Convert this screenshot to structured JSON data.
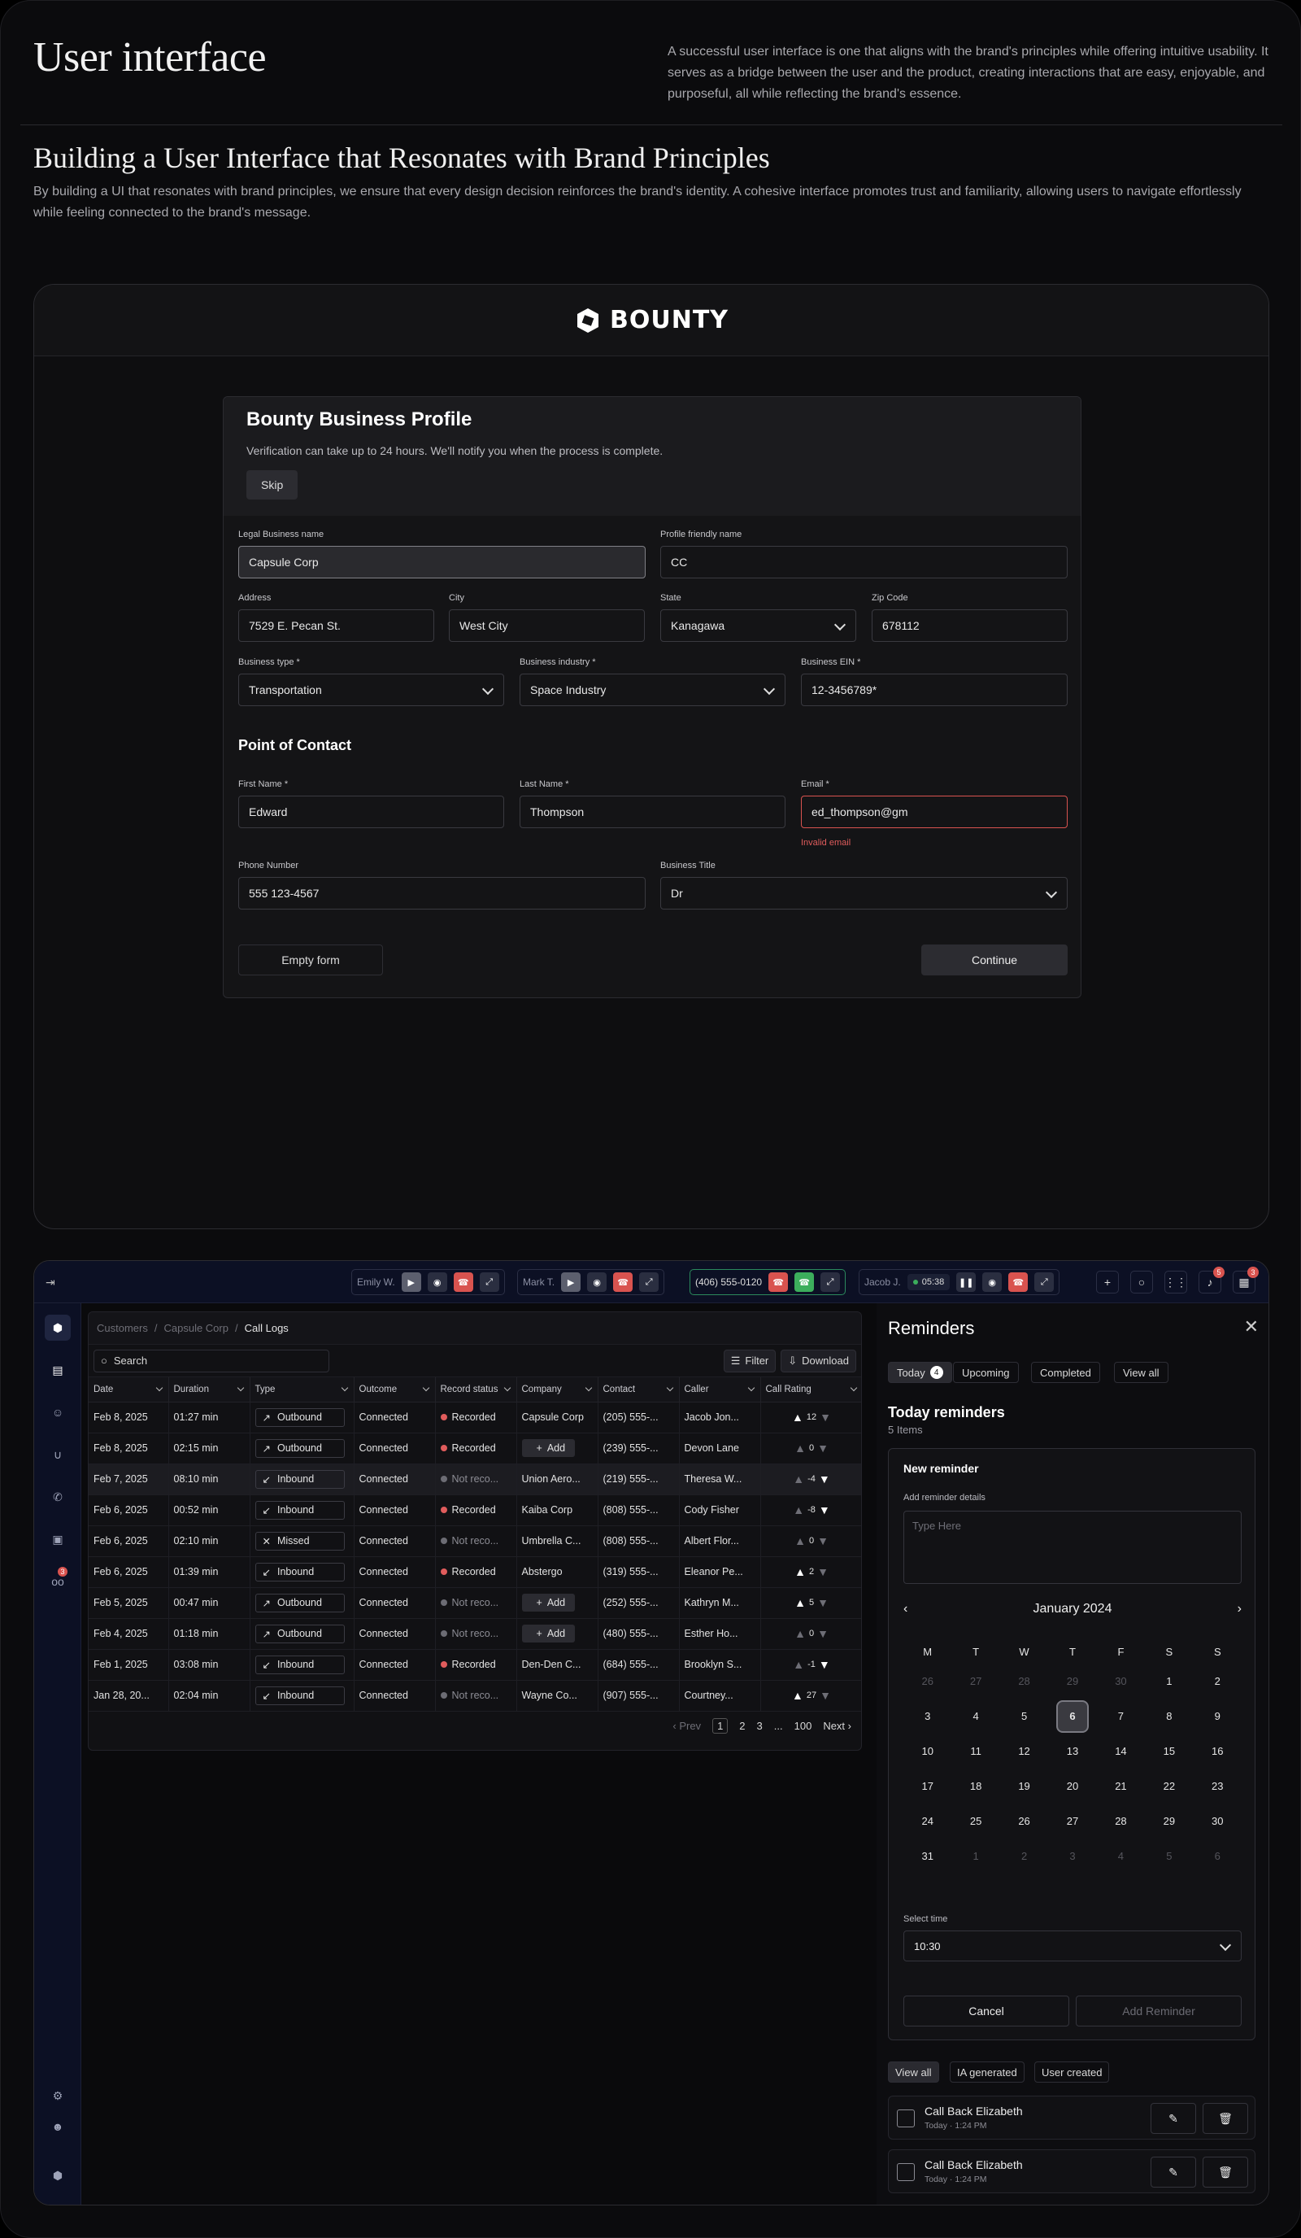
{
  "hero": {
    "title": "User interface",
    "intro": "A successful user interface is one that aligns with the brand's principles while offering intuitive usability. It serves as a bridge between the user and the product, creating interactions that are easy, enjoyable, and purposeful, all while reflecting the brand's essence.",
    "heading": "Building a User Interface that Resonates with Brand Principles",
    "subtext": "By building a UI that resonates with brand principles, we ensure that every design decision reinforces the brand's identity. A cohesive interface promotes trust and familiarity, allowing users to navigate effortlessly while feeling connected to the brand's message."
  },
  "brand": {
    "name": "BOUNTY"
  },
  "profile": {
    "title": "Bounty Business Profile",
    "note": "Verification can take up to 24 hours. We'll notify you when the process is complete.",
    "skip": "Skip",
    "legal_label": "Legal Business name",
    "legal_value": "Capsule Corp",
    "friendly_label": "Profile friendly name",
    "friendly_value": "CC",
    "address_label": "Address",
    "address_value": "7529 E. Pecan St.",
    "city_label": "City",
    "city_value": "West City",
    "state_label": "State",
    "state_value": "Kanagawa",
    "zip_label": "Zip Code",
    "zip_value": "678112",
    "btype_label": "Business type *",
    "btype_value": "Transportation",
    "bindustry_label": "Business industry *",
    "bindustry_value": "Space Industry",
    "ein_label": "Business EIN *",
    "ein_value": "12-3456789*",
    "contact_heading": "Point of Contact",
    "first_label": "First Name *",
    "first_value": "Edward",
    "last_label": "Last Name *",
    "last_value": "Thompson",
    "email_label": "Email *",
    "email_value": "ed_thompson@gm",
    "email_error": "Invalid email",
    "phone_label": "Phone Number",
    "phone_value": "555 123-4567",
    "title_label": "Business Title",
    "title_value": "Dr",
    "empty_button": "Empty form",
    "continue_button": "Continue"
  },
  "callbar": {
    "agent1": "Emily W.",
    "agent2": "Mark T.",
    "live_number": "(406) 555-0120",
    "agent3": "Jacob J.",
    "timer": "05:38",
    "notif_count": "5",
    "calendar_count": "3",
    "rail_badge": "3"
  },
  "logs": {
    "breadcrumb": [
      "Customers",
      "Capsule Corp",
      "Call Logs"
    ],
    "search_placeholder": "Search",
    "filter": "Filter",
    "download": "Download",
    "columns": [
      "Date",
      "Duration",
      "Type",
      "Outcome",
      "Record status",
      "Company",
      "Contact",
      "Caller",
      "Call Rating"
    ],
    "rows": [
      {
        "date": "Feb 8, 2025",
        "duration": "01:27 min",
        "type": "Outbound",
        "outcome": "Connected",
        "record": "Recorded",
        "company": "Capsule Corp",
        "contact": "(205) 555-...",
        "caller": "Jacob Jon...",
        "rating": "12"
      },
      {
        "date": "Feb 8, 2025",
        "duration": "02:15 min",
        "type": "Outbound",
        "outcome": "Connected",
        "record": "Recorded",
        "company": "Add",
        "contact": "(239) 555-...",
        "caller": "Devon Lane",
        "rating": "0"
      },
      {
        "date": "Feb 7, 2025",
        "duration": "08:10 min",
        "type": "Inbound",
        "outcome": "Connected",
        "record": "Not reco...",
        "company": "Union Aero...",
        "contact": "(219) 555-...",
        "caller": "Theresa W...",
        "rating": "-4"
      },
      {
        "date": "Feb 6, 2025",
        "duration": "00:52 min",
        "type": "Inbound",
        "outcome": "Connected",
        "record": "Recorded",
        "company": "Kaiba Corp",
        "contact": "(808) 555-...",
        "caller": "Cody Fisher",
        "rating": "-8"
      },
      {
        "date": "Feb 6, 2025",
        "duration": "02:10 min",
        "type": "Missed",
        "outcome": "Connected",
        "record": "Not reco...",
        "company": "Umbrella C...",
        "contact": "(808) 555-...",
        "caller": "Albert Flor...",
        "rating": "0"
      },
      {
        "date": "Feb 6, 2025",
        "duration": "01:39 min",
        "type": "Inbound",
        "outcome": "Connected",
        "record": "Recorded",
        "company": "Abstergo",
        "contact": "(319) 555-...",
        "caller": "Eleanor Pe...",
        "rating": "2"
      },
      {
        "date": "Feb 5, 2025",
        "duration": "00:47 min",
        "type": "Outbound",
        "outcome": "Connected",
        "record": "Not reco...",
        "company": "Add",
        "contact": "(252) 555-...",
        "caller": "Kathryn M...",
        "rating": "5"
      },
      {
        "date": "Feb 4, 2025",
        "duration": "01:18 min",
        "type": "Outbound",
        "outcome": "Connected",
        "record": "Not reco...",
        "company": "Add",
        "contact": "(480) 555-...",
        "caller": "Esther Ho...",
        "rating": "0"
      },
      {
        "date": "Feb 1, 2025",
        "duration": "03:08 min",
        "type": "Inbound",
        "outcome": "Connected",
        "record": "Recorded",
        "company": "Den-Den C...",
        "contact": "(684) 555-...",
        "caller": "Brooklyn S...",
        "rating": "-1"
      },
      {
        "date": "Jan 28, 20...",
        "duration": "02:04 min",
        "type": "Inbound",
        "outcome": "Connected",
        "record": "Not reco...",
        "company": "Wayne Co...",
        "contact": "(907) 555-...",
        "caller": "Courtney...",
        "rating": "27"
      }
    ],
    "pager": {
      "prev": "Prev",
      "pages": [
        "1",
        "2",
        "3",
        "...",
        "100"
      ],
      "next": "Next"
    }
  },
  "reminders": {
    "title": "Reminders",
    "tabs": [
      "Today",
      "Upcoming",
      "Completed",
      "View all"
    ],
    "today_count": "4",
    "heading": "Today reminders",
    "count": "5 Items",
    "new_title": "New reminder",
    "details_label": "Add reminder details",
    "details_placeholder": "Type Here",
    "month": "January 2024",
    "weekdays": [
      "M",
      "T",
      "W",
      "T",
      "F",
      "S",
      "S"
    ],
    "days": [
      "26",
      "27",
      "28",
      "29",
      "30",
      "1",
      "2",
      "3",
      "4",
      "5",
      "6",
      "7",
      "8",
      "9",
      "10",
      "11",
      "12",
      "13",
      "14",
      "15",
      "16",
      "17",
      "18",
      "19",
      "20",
      "21",
      "22",
      "23",
      "24",
      "25",
      "26",
      "27",
      "28",
      "29",
      "30",
      "31",
      "1",
      "2",
      "3",
      "4",
      "5",
      "6"
    ],
    "selected_day": "6",
    "time_label": "Select time",
    "time_value": "10:30",
    "cancel": "Cancel",
    "add": "Add Reminder",
    "filters": [
      "View all",
      "IA generated",
      "User created"
    ],
    "items": [
      {
        "title": "Call Back Elizabeth",
        "sub": "Today · 1:24 PM"
      },
      {
        "title": "Call Back Elizabeth",
        "sub": "Today · 1:24 PM"
      }
    ]
  }
}
